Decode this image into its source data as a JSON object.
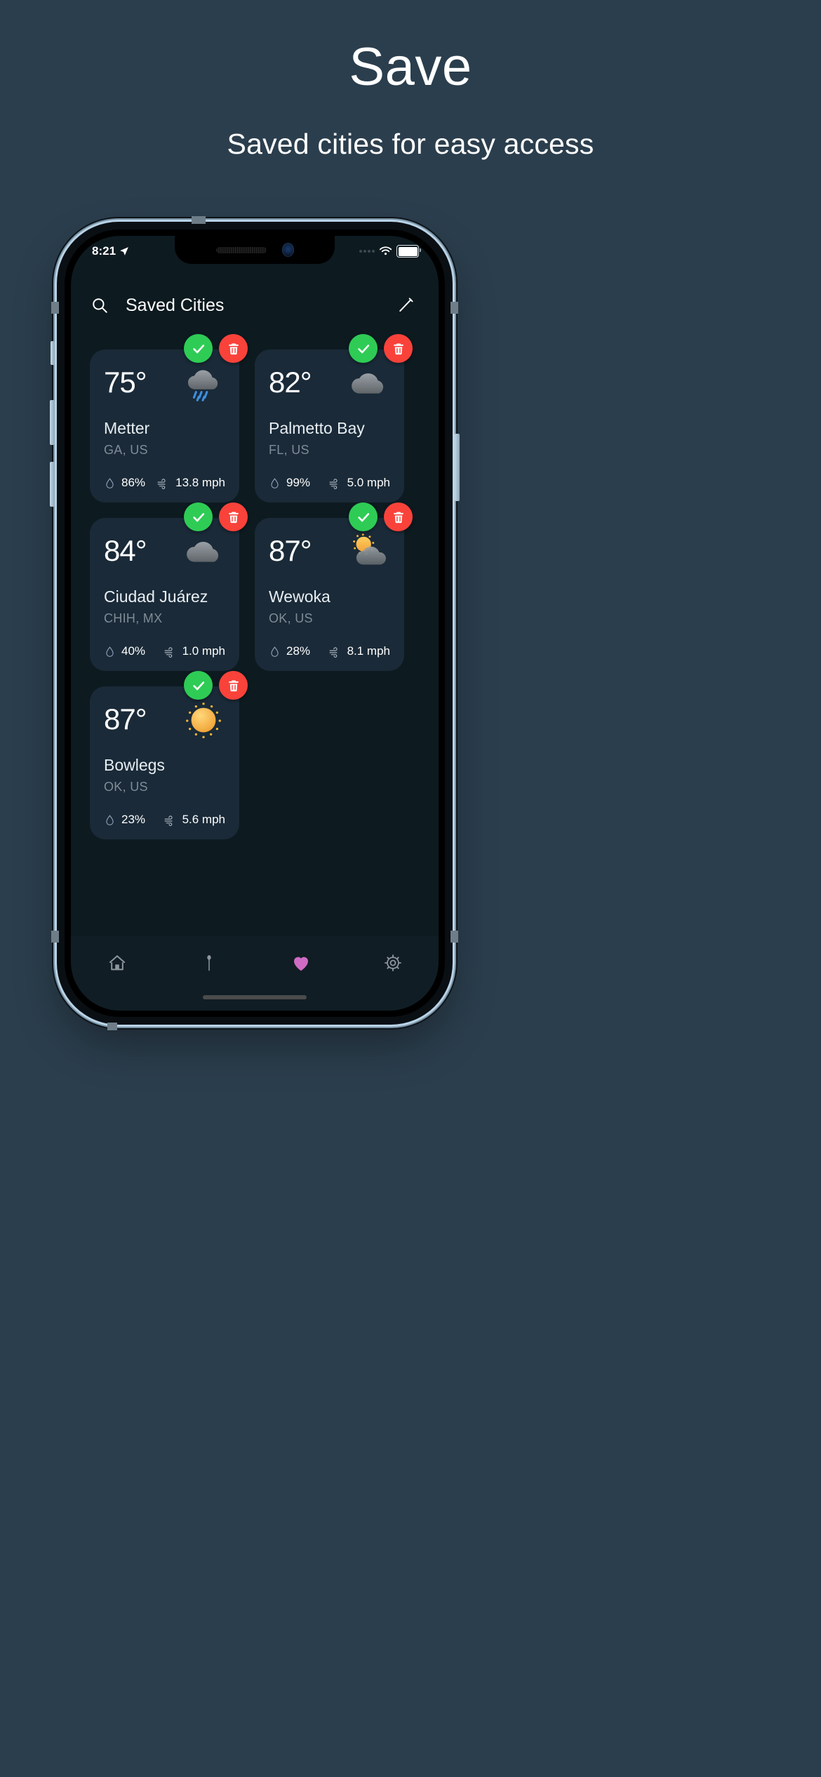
{
  "promo": {
    "title": "Save",
    "subtitle": "Saved cities for easy access"
  },
  "status_bar": {
    "time": "8:21",
    "location_icon": "location-arrow-icon",
    "signal_icon": "signal-dots-icon",
    "wifi_icon": "wifi-icon",
    "battery_icon": "battery-full-icon"
  },
  "app_header": {
    "search_icon": "search-icon",
    "title": "Saved Cities",
    "edit_icon": "pencil-icon"
  },
  "cards": [
    {
      "temperature": "75°",
      "city": "Metter",
      "region": "GA, US",
      "humidity": "86%",
      "wind": "13.8 mph",
      "weather_icon": "rain-cloud-icon",
      "confirm_icon": "check-icon",
      "delete_icon": "trash-icon"
    },
    {
      "temperature": "82°",
      "city": "Palmetto Bay",
      "region": "FL, US",
      "humidity": "99%",
      "wind": "5.0 mph",
      "weather_icon": "cloud-icon",
      "confirm_icon": "check-icon",
      "delete_icon": "trash-icon"
    },
    {
      "temperature": "84°",
      "city": "Ciudad Juárez",
      "region": "CHIH, MX",
      "humidity": "40%",
      "wind": "1.0 mph",
      "weather_icon": "cloud-icon",
      "confirm_icon": "check-icon",
      "delete_icon": "trash-icon"
    },
    {
      "temperature": "87°",
      "city": "Wewoka",
      "region": "OK, US",
      "humidity": "28%",
      "wind": "8.1 mph",
      "weather_icon": "sun-behind-cloud-icon",
      "confirm_icon": "check-icon",
      "delete_icon": "trash-icon"
    },
    {
      "temperature": "87°",
      "city": "Bowlegs",
      "region": "OK, US",
      "humidity": "23%",
      "wind": "5.6 mph",
      "weather_icon": "sun-icon",
      "confirm_icon": "check-icon",
      "delete_icon": "trash-icon"
    }
  ],
  "bottom_nav": [
    {
      "icon": "home-icon",
      "active": false
    },
    {
      "icon": "map-pin-icon",
      "active": false
    },
    {
      "icon": "heart-icon",
      "active": true
    },
    {
      "icon": "gear-icon",
      "active": false
    }
  ],
  "colors": {
    "page_background": "#2b3e4d",
    "screen_background": "#0d1a20",
    "card_background": "#1a2a38",
    "nav_background": "#101d24",
    "confirm_green": "#2ecc55",
    "delete_red": "#f9423a",
    "accent_pink": "#cf6bc4",
    "muted_text": "#7f8c96"
  }
}
